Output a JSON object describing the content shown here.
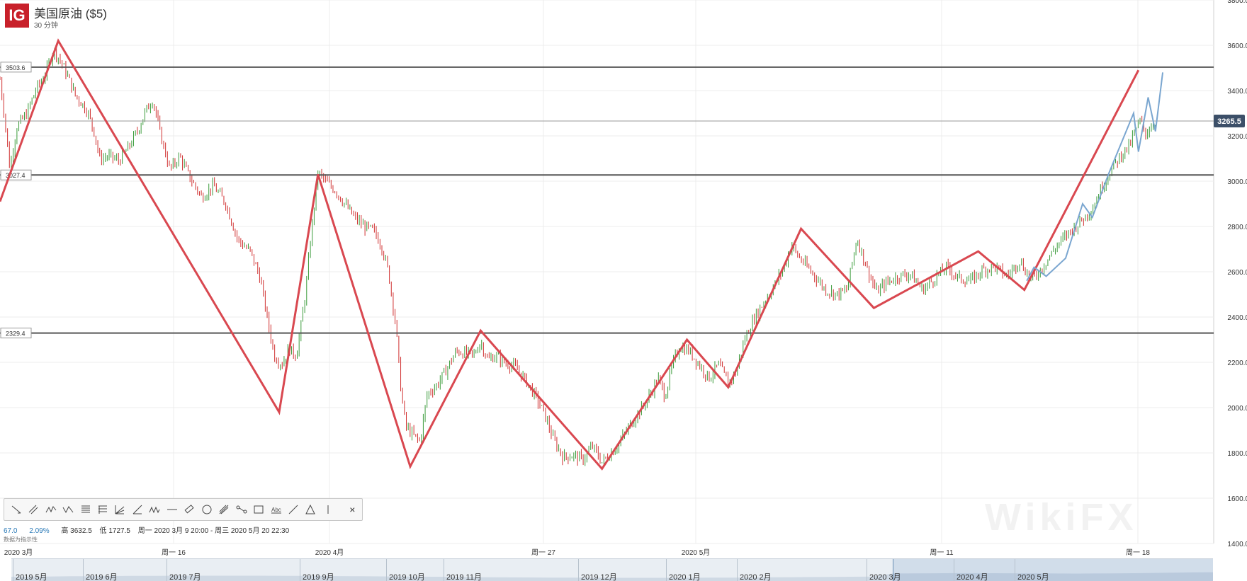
{
  "header": {
    "logo": "IG",
    "title": "美国原油 ($5)",
    "subtitle": "30 分钟"
  },
  "toolbar": {
    "tools": [
      "trend-line-icon",
      "channel-icon",
      "wave-icon",
      "zigzag-icon",
      "grid-icon",
      "fib-retracement-icon",
      "fan-icon",
      "angle-icon",
      "pattern-icon",
      "horizontal-line-icon",
      "ruler-icon",
      "circle-icon",
      "pitchfork-icon",
      "path-icon",
      "rectangle-icon",
      "text-icon",
      "diagonal-line-icon",
      "triangle-icon",
      "vertical-line-icon"
    ],
    "close_label": "×"
  },
  "info": {
    "change": "67.0",
    "change_pct": "2.09%",
    "high": "高 3632.5",
    "low": "低 1727.5",
    "range": "周一 2020 3月 9 20:00 - 周三 2020 5月 20 22:30"
  },
  "note": "数据为指示性",
  "watermark": "WikiFX",
  "navigator": {
    "labels": [
      "2019 5月",
      "2019 6月",
      "2019 7月",
      "2019 9月",
      "2019 10月",
      "2019 11月",
      "2019 12月",
      "2020 1月",
      "2020 2月",
      "2020 3月",
      "2020 4月",
      "2020 5月"
    ]
  },
  "colors": {
    "zigzag": "#d94850",
    "projection": "#7aa6d0",
    "price_tag": "#3c4f68",
    "up": "#3a9b3a",
    "down": "#d03030"
  },
  "chart_data": {
    "type": "candlestick",
    "title": "美国原油 ($5)",
    "interval": "30 分钟",
    "ylim": [
      1400,
      3800
    ],
    "y_ticks": [
      "3800.0",
      "3600.0",
      "3400.0",
      "3200.0",
      "3000.0",
      "2800.0",
      "2600.0",
      "2400.0",
      "2200.0",
      "2000.0",
      "1800.0",
      "1600.0",
      "1400.0"
    ],
    "x_ticks": [
      "2020 3月",
      "周一 16",
      "2020 4月",
      "周一 27",
      "2020 5月",
      "周一 11",
      "周一 18"
    ],
    "x_range": [
      0,
      1000
    ],
    "current_price": 3265.5,
    "current_price_label": "3265.5",
    "horizontal_levels": [
      {
        "value": 3503.6,
        "label": "3503.6"
      },
      {
        "value": 3027.4,
        "label": "3027.4"
      },
      {
        "value": 2329.4,
        "label": "2329.4"
      }
    ],
    "price_path": [
      [
        0,
        3450
      ],
      [
        4,
        3270
      ],
      [
        8,
        3060
      ],
      [
        14,
        3240
      ],
      [
        22,
        3300
      ],
      [
        30,
        3410
      ],
      [
        38,
        3480
      ],
      [
        44,
        3580
      ],
      [
        50,
        3530
      ],
      [
        56,
        3460
      ],
      [
        62,
        3380
      ],
      [
        72,
        3310
      ],
      [
        78,
        3210
      ],
      [
        82,
        3100
      ],
      [
        90,
        3110
      ],
      [
        98,
        3090
      ],
      [
        106,
        3150
      ],
      [
        114,
        3230
      ],
      [
        120,
        3310
      ],
      [
        126,
        3360
      ],
      [
        132,
        3210
      ],
      [
        140,
        3050
      ],
      [
        148,
        3110
      ],
      [
        156,
        3020
      ],
      [
        166,
        2930
      ],
      [
        176,
        2980
      ],
      [
        186,
        2900
      ],
      [
        196,
        2740
      ],
      [
        206,
        2690
      ],
      [
        214,
        2580
      ],
      [
        220,
        2400
      ],
      [
        226,
        2230
      ],
      [
        232,
        2190
      ],
      [
        238,
        2260
      ],
      [
        244,
        2230
      ],
      [
        248,
        2360
      ],
      [
        252,
        2520
      ],
      [
        256,
        2750
      ],
      [
        262,
        3040
      ],
      [
        268,
        3000
      ],
      [
        276,
        2960
      ],
      [
        284,
        2900
      ],
      [
        292,
        2840
      ],
      [
        300,
        2800
      ],
      [
        308,
        2780
      ],
      [
        314,
        2720
      ],
      [
        320,
        2600
      ],
      [
        326,
        2370
      ],
      [
        330,
        2100
      ],
      [
        334,
        1920
      ],
      [
        340,
        1880
      ],
      [
        346,
        1850
      ],
      [
        352,
        2060
      ],
      [
        360,
        2100
      ],
      [
        368,
        2170
      ],
      [
        376,
        2250
      ],
      [
        384,
        2240
      ],
      [
        390,
        2230
      ],
      [
        396,
        2290
      ],
      [
        402,
        2210
      ],
      [
        408,
        2230
      ],
      [
        416,
        2200
      ],
      [
        424,
        2180
      ],
      [
        432,
        2130
      ],
      [
        440,
        2060
      ],
      [
        448,
        1980
      ],
      [
        456,
        1860
      ],
      [
        464,
        1780
      ],
      [
        472,
        1790
      ],
      [
        480,
        1770
      ],
      [
        488,
        1830
      ],
      [
        496,
        1760
      ],
      [
        504,
        1800
      ],
      [
        512,
        1860
      ],
      [
        520,
        1930
      ],
      [
        528,
        1990
      ],
      [
        536,
        2060
      ],
      [
        542,
        2130
      ],
      [
        548,
        2050
      ],
      [
        554,
        2190
      ],
      [
        560,
        2270
      ],
      [
        568,
        2250
      ],
      [
        576,
        2190
      ],
      [
        584,
        2130
      ],
      [
        592,
        2190
      ],
      [
        600,
        2110
      ],
      [
        606,
        2150
      ],
      [
        614,
        2310
      ],
      [
        622,
        2400
      ],
      [
        630,
        2470
      ],
      [
        638,
        2540
      ],
      [
        646,
        2620
      ],
      [
        652,
        2720
      ],
      [
        656,
        2680
      ],
      [
        662,
        2640
      ],
      [
        670,
        2590
      ],
      [
        680,
        2520
      ],
      [
        690,
        2500
      ],
      [
        698,
        2520
      ],
      [
        706,
        2750
      ],
      [
        714,
        2620
      ],
      [
        722,
        2510
      ],
      [
        730,
        2550
      ],
      [
        740,
        2580
      ],
      [
        750,
        2590
      ],
      [
        760,
        2520
      ],
      [
        770,
        2570
      ],
      [
        780,
        2620
      ],
      [
        790,
        2570
      ],
      [
        800,
        2560
      ],
      [
        810,
        2610
      ],
      [
        820,
        2620
      ],
      [
        830,
        2580
      ],
      [
        840,
        2650
      ],
      [
        850,
        2560
      ],
      [
        860,
        2630
      ],
      [
        870,
        2710
      ],
      [
        880,
        2770
      ],
      [
        890,
        2820
      ],
      [
        900,
        2880
      ],
      [
        910,
        3000
      ],
      [
        918,
        3070
      ],
      [
        924,
        3120
      ],
      [
        930,
        3150
      ],
      [
        936,
        3230
      ],
      [
        940,
        3270
      ],
      [
        944,
        3210
      ],
      [
        948,
        3240
      ],
      [
        952,
        3260
      ]
    ],
    "zigzag": [
      [
        0,
        2910
      ],
      [
        48,
        3620
      ],
      [
        230,
        1980
      ],
      [
        262,
        3030
      ],
      [
        338,
        1740
      ],
      [
        396,
        2340
      ],
      [
        496,
        1730
      ],
      [
        566,
        2300
      ],
      [
        600,
        2090
      ],
      [
        660,
        2790
      ],
      [
        720,
        2440
      ],
      [
        806,
        2690
      ],
      [
        844,
        2520
      ],
      [
        938,
        3490
      ]
    ],
    "projection": [
      [
        846,
        2560
      ],
      [
        852,
        2620
      ],
      [
        862,
        2580
      ],
      [
        878,
        2660
      ],
      [
        892,
        2900
      ],
      [
        900,
        2840
      ],
      [
        914,
        3040
      ],
      [
        934,
        3300
      ],
      [
        938,
        3130
      ],
      [
        946,
        3370
      ],
      [
        952,
        3220
      ],
      [
        958,
        3480
      ]
    ]
  }
}
